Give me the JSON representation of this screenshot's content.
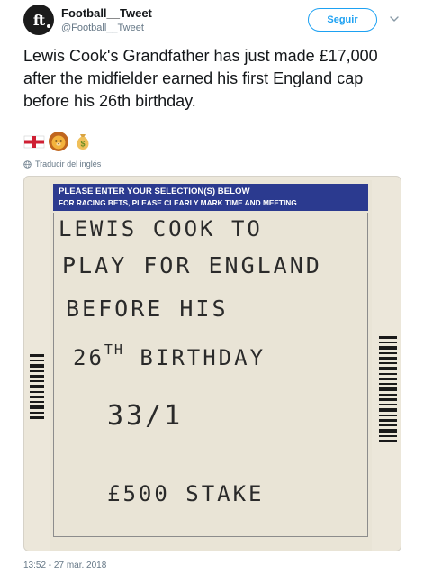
{
  "account": {
    "display_name": "Football__Tweet",
    "handle": "@Football__Tweet",
    "avatar_text": "ft",
    "avatar_icon": "ft-logo-avatar"
  },
  "actions": {
    "follow_label": "Seguir",
    "menu_icon": "chevron-down-icon"
  },
  "tweet": {
    "text": "Lewis Cook's Grandfather has just made £17,000 after the midfielder earned his first England cap before his 26th birthday.",
    "emojis": [
      "england-flag-icon",
      "lion-face-icon",
      "money-bag-icon"
    ],
    "translate_label": "Traducir del inglés",
    "translate_icon": "globe-icon",
    "timestamp": "13:52 - 27 mar. 2018"
  },
  "media": {
    "header_line1": "PLEASE ENTER YOUR SELECTION(S) BELOW",
    "header_line2": "FOR RACING BETS, PLEASE CLEARLY MARK TIME AND MEETING",
    "hw_line1": "LEWIS  COOK TO",
    "hw_line2": "PLAY  FOR ENGLAND",
    "hw_line3": "BEFORE  HIS",
    "hw_line4_a": "26",
    "hw_line4_sup": "TH",
    "hw_line4_b": " BIRTHDAY",
    "hw_odds": "33/1",
    "hw_stake": "£500 STAKE",
    "colors": {
      "header": "#2b3a8f",
      "paper": "#e9e4d6"
    }
  },
  "colors": {
    "accent": "#1da1f2",
    "text": "#14171a",
    "muted": "#657786"
  }
}
